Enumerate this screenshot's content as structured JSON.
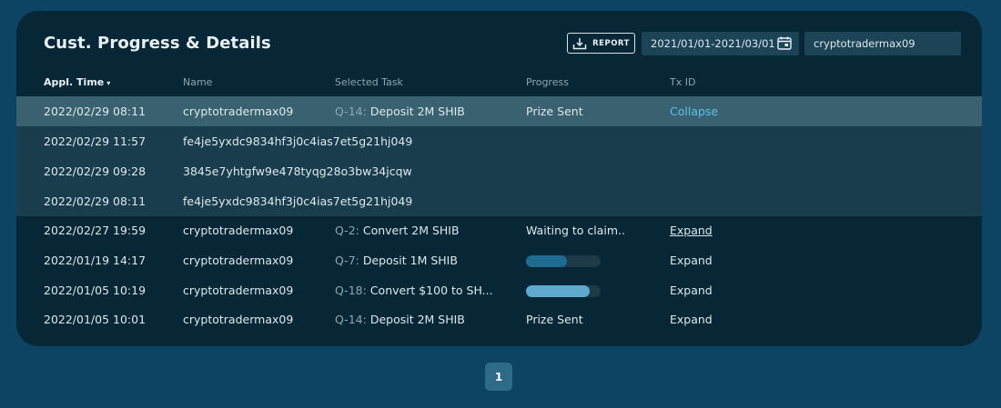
{
  "header": {
    "title": "Cust. Progress & Details",
    "report_label": "REPORT",
    "date_range": "2021/01/01-2021/03/01",
    "search_value": "cryptotradermax09"
  },
  "columns": {
    "time": "Appl. Time",
    "time_sort_icon": "▾",
    "name": "Name",
    "task": "Selected Task",
    "progress": "Progress",
    "txid": "Tx ID"
  },
  "rows": [
    {
      "time": "2022/02/29 08:11",
      "name": "cryptotradermax09",
      "task_id": "Q-14:",
      "task": "Deposit 2M SHIB",
      "progress_text": "Prize Sent",
      "txid": "Collapse"
    },
    {
      "time": "2022/02/29 11:57",
      "name": "fe4je5yxdc9834hf3j0c4ias7et5g21hj049"
    },
    {
      "time": "2022/02/29 09:28",
      "name": "3845e7yhtgfw9e478tyqg28o3bw34jcqw"
    },
    {
      "time": "2022/02/29 08:11",
      "name": "fe4je5yxdc9834hf3j0c4ias7et5g21hj049"
    },
    {
      "time": "2022/02/27 19:59",
      "name": "cryptotradermax09",
      "task_id": "Q-2:",
      "task": "Convert 2M SHIB",
      "progress_text": "Waiting to claim..",
      "txid": "Expand"
    },
    {
      "time": "2022/01/19 14:17",
      "name": "cryptotradermax09",
      "task_id": "Q-7:",
      "task": "Deposit 1M SHIB",
      "progress_fraction": 0.55,
      "txid": "Expand"
    },
    {
      "time": "2022/01/05 10:19",
      "name": "cryptotradermax09",
      "task_id": "Q-18:",
      "task": "Convert $100 to SH...",
      "progress_fraction": 0.85,
      "txid": "Expand"
    },
    {
      "time": "2022/01/05 10:01",
      "name": "cryptotradermax09",
      "task_id": "Q-14:",
      "task": "Deposit 2M SHIB",
      "progress_text": "Prize Sent",
      "txid": "Expand"
    }
  ],
  "colors": {
    "bar_fill_partial": "#1f6b92",
    "bar_fill_high": "#5fa9cf",
    "accent": "#5cc0e8"
  },
  "pagination": {
    "current_page": "1"
  }
}
